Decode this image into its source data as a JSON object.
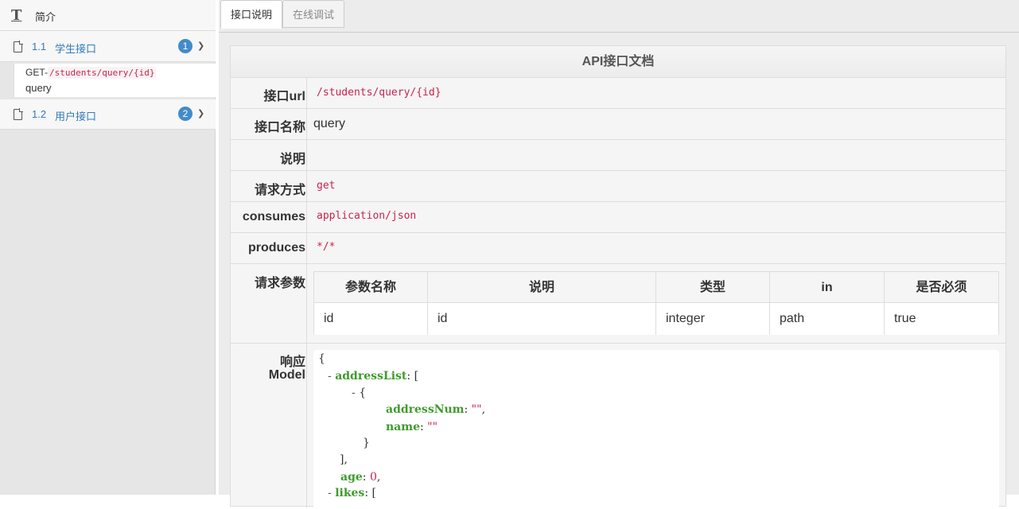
{
  "sidebar": {
    "intro_label": "简介",
    "groups": [
      {
        "num": "1.1",
        "name": "学生接口",
        "badge": "1"
      },
      {
        "num": "1.2",
        "name": "用户接口",
        "badge": "2"
      }
    ],
    "endpoint": {
      "method": "GET-",
      "path": "/students/query/{id}",
      "name": "query"
    }
  },
  "tabs": {
    "doc": "接口说明",
    "debug": "在线调试"
  },
  "doc": {
    "title": "API接口文档",
    "rows": [
      {
        "label": "接口url",
        "value": "/students/query/{id}"
      },
      {
        "label": "接口名称",
        "value": "query"
      },
      {
        "label": "说明",
        "value": ""
      },
      {
        "label": "请求方式",
        "value": "get"
      },
      {
        "label": "consumes",
        "value": "application/json"
      },
      {
        "label": "produces",
        "value": "*/*"
      }
    ],
    "params_label": "请求参数",
    "params_headers": [
      "参数名称",
      "说明",
      "类型",
      "in",
      "是否必须"
    ],
    "params_row": [
      "id",
      "id",
      "integer",
      "path",
      "true"
    ],
    "response_label_1": "响应",
    "response_label_2": "Model",
    "model": {
      "open": "{",
      "minus": "-",
      "k_addressList": "addressList",
      "colon": ":",
      "open_bracket": "[",
      "k_addressNum": "addressNum",
      "empty_str": "\"\"",
      "comma": ",",
      "k_name": "name",
      "close_brace": "}",
      "close_bracket_comma": "],",
      "k_age": "age",
      "age_value": "0",
      "k_likes": "likes"
    }
  }
}
